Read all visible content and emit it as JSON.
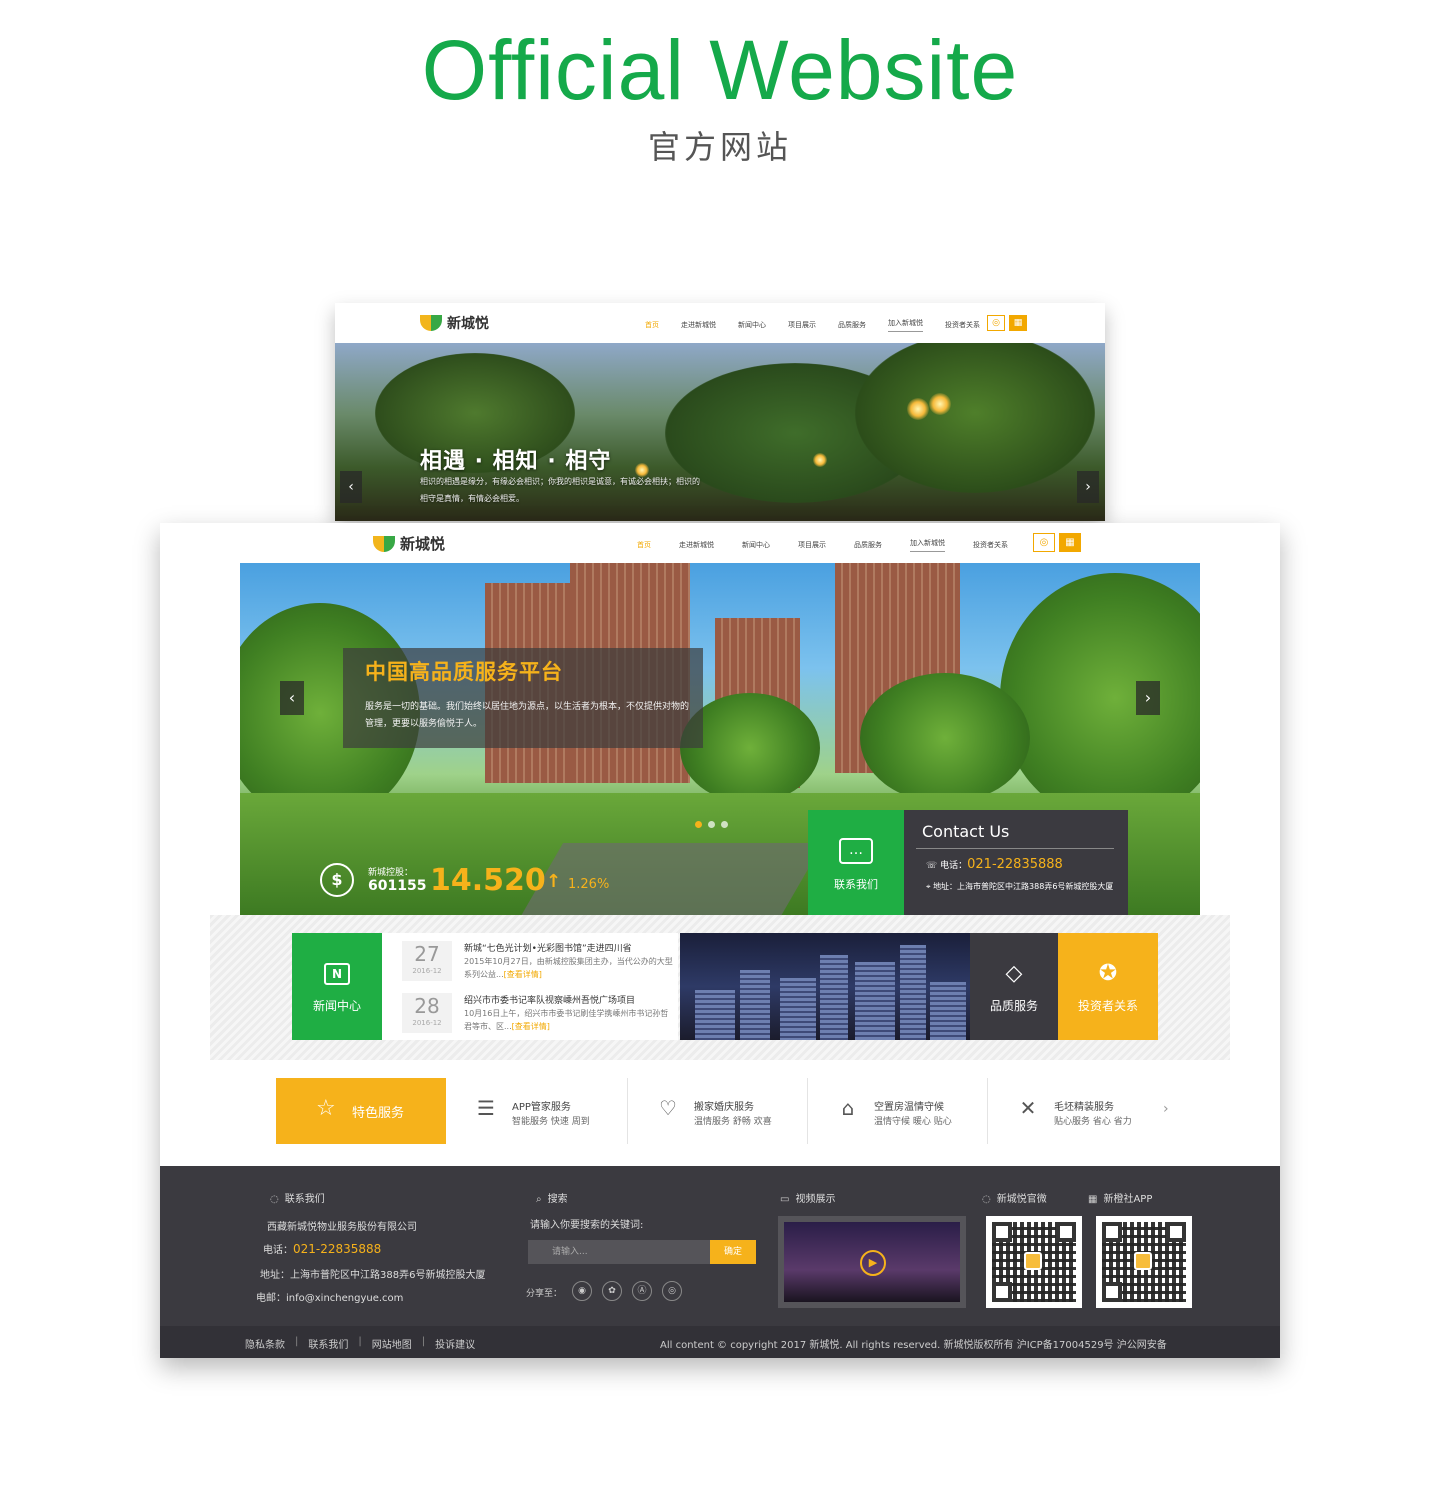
{
  "header": {
    "title": "Official Website",
    "subtitle": "官方网站"
  },
  "site": {
    "logo_text": "新城悦",
    "nav": [
      "首页",
      "走进新城悦",
      "新闻中心",
      "项目展示",
      "品质服务",
      "加入新城悦",
      "投资者关系"
    ]
  },
  "back_banner": {
    "title": "相遇 · 相知 · 相守",
    "text": "相识的相遇是缘分，有缘必会相识；你我的相识是诚意，有诚必会相扶；相识的相守是真情，有情必会相爱。"
  },
  "front_banner": {
    "title": "中国高品质服务平台",
    "text": "服务是一切的基础。我们始终以居住地为源点，以生活者为根本，不仅提供对物的管理，更要以服务偷悦于人。"
  },
  "stock": {
    "name": "新城控股：",
    "code": "601155",
    "price": "14.520",
    "change": "1.26%"
  },
  "contact": {
    "button_label": "联系我们",
    "title": "Contact Us",
    "phone_label": "电话：",
    "phone": "021-22835888",
    "address": "地址：上海市普陀区中江路388弄6号新城控股大厦"
  },
  "news": {
    "label": "新闻中心",
    "items": [
      {
        "day": "27",
        "month": "2016-12",
        "title": "新城“七色光计划•光彩图书馆”走进四川省",
        "desc": "2015年10月27日，由新城控股集团主办，当代公办的大型系列公益...",
        "more": "[查看详情]"
      },
      {
        "day": "28",
        "month": "2016-12",
        "title": "绍兴市市委书记率队视察嵊州吾悦广场项目",
        "desc": "10月16日上午，绍兴市市委书记刷佳学携嵊州市书记孙哲君等市、区...",
        "more": "[查看详情]"
      }
    ]
  },
  "tiles": {
    "quality": "品质服务",
    "investor": "投资者关系"
  },
  "services": {
    "label": "特色服务",
    "items": [
      {
        "title": "APP管家服务",
        "sub": "智能服务 快速 周到"
      },
      {
        "title": "搬家婚庆服务",
        "sub": "温情服务 舒畅 欢喜"
      },
      {
        "title": "空置房温情守候",
        "sub": "温情守候 暖心 贴心"
      },
      {
        "title": "毛坯精装服务",
        "sub": "贴心服务 省心 省力"
      }
    ]
  },
  "footer": {
    "contact_head": "联系我们",
    "company": "西藏新城悦物业服务股份有限公司",
    "phone_label": "电话：",
    "phone": "021-22835888",
    "address": "地址：上海市普陀区中江路388弄6号新城控股大厦",
    "email": "电邮：info@xinchengyue.com",
    "search_head": "搜索",
    "search_prompt": "请输入你要搜索的关键词:",
    "search_placeholder": "请输入...",
    "search_button": "确定",
    "share_label": "分享至：",
    "video_head": "视频展示",
    "qr1_head": "新城悦官微",
    "qr2_head": "新橙社APP"
  },
  "bottom": {
    "links": [
      "隐私条款",
      "联系我们",
      "网站地图",
      "投诉建议"
    ],
    "copyright": "All content © copyright 2017 新城悦. All rights reserved. 新城悦版权所有 沪ICP备17004529号 沪公网安备"
  },
  "colors": {
    "brand_green": "#1fae44",
    "accent_yellow": "#f6b21b",
    "dark": "#3b3a40",
    "title_green": "#15a94a"
  }
}
